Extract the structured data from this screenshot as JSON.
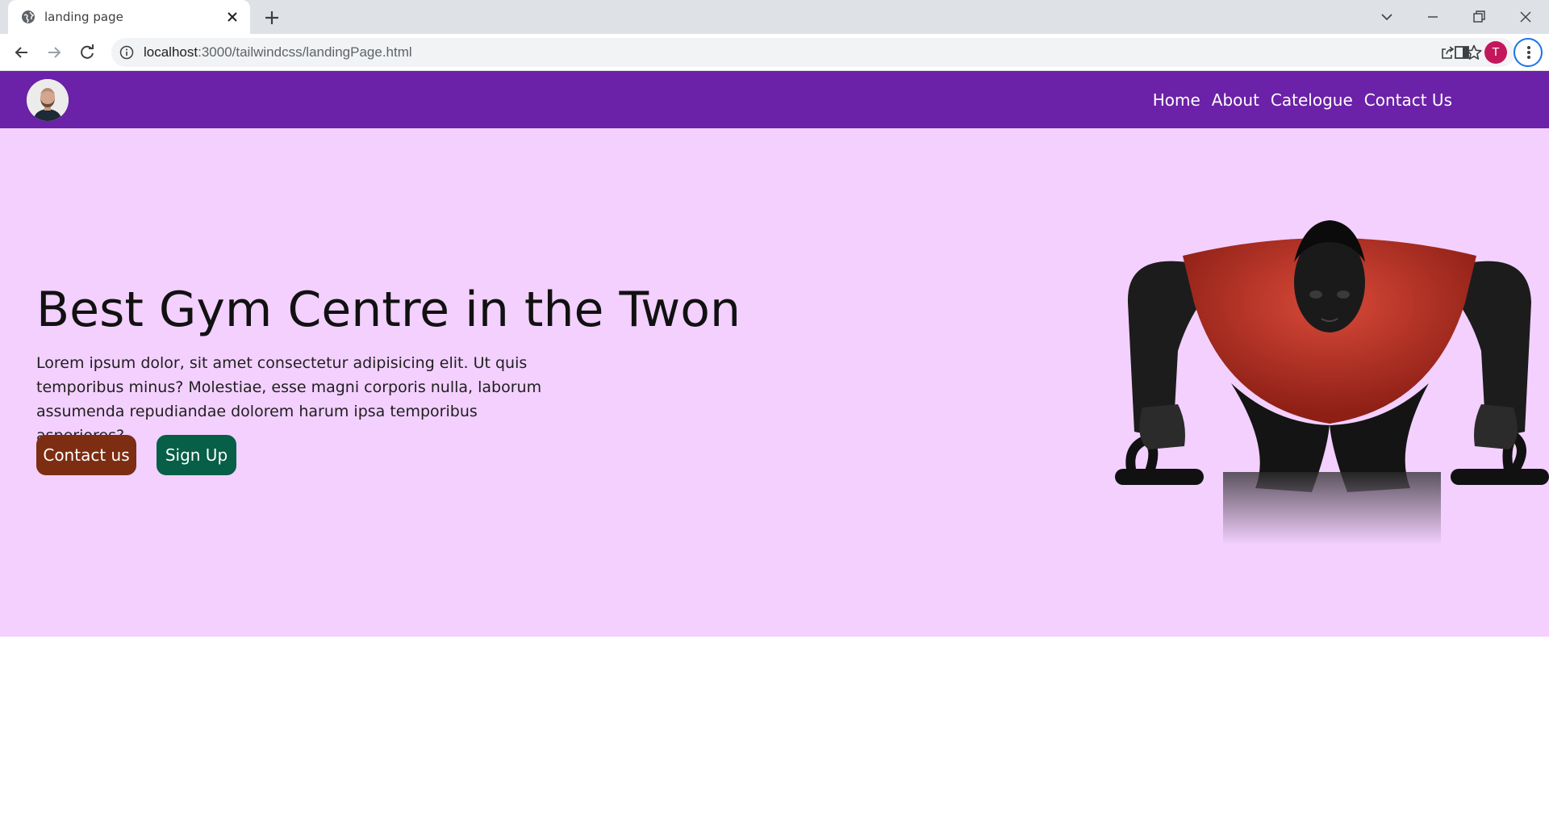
{
  "browser": {
    "tab_title": "landing page",
    "url_host": "localhost",
    "url_path": ":3000/tailwindcss/landingPage.html",
    "profile_initial": "T",
    "icons": [
      "globe-icon",
      "close-icon",
      "plus-icon",
      "chevron-down-icon",
      "minimize-icon",
      "restore-icon",
      "window-close-icon",
      "back-arrow-icon",
      "forward-arrow-icon",
      "reload-icon",
      "info-icon",
      "share-icon",
      "star-icon",
      "side-panel-icon",
      "kebab-menu-icon"
    ]
  },
  "nav": {
    "links": [
      "Home",
      "About",
      "Catelogue",
      "Contact Us"
    ]
  },
  "hero": {
    "title": "Best Gym Centre in the Twon",
    "body": "Lorem ipsum dolor, sit amet consectetur adipisicing elit. Ut quis temporibus minus? Molestiae, esse magni corporis nulla, laborum assumenda repudiandae dolorem harum ipsa temporibus asperiores?",
    "contact_button": "Contact us",
    "signup_button": "Sign Up"
  },
  "colors": {
    "navbar": "#6b21a8",
    "hero_bg": "#f3d0fe",
    "contact_button": "#7c2d12",
    "signup_button": "#065f46",
    "profile": "#c2185b"
  }
}
